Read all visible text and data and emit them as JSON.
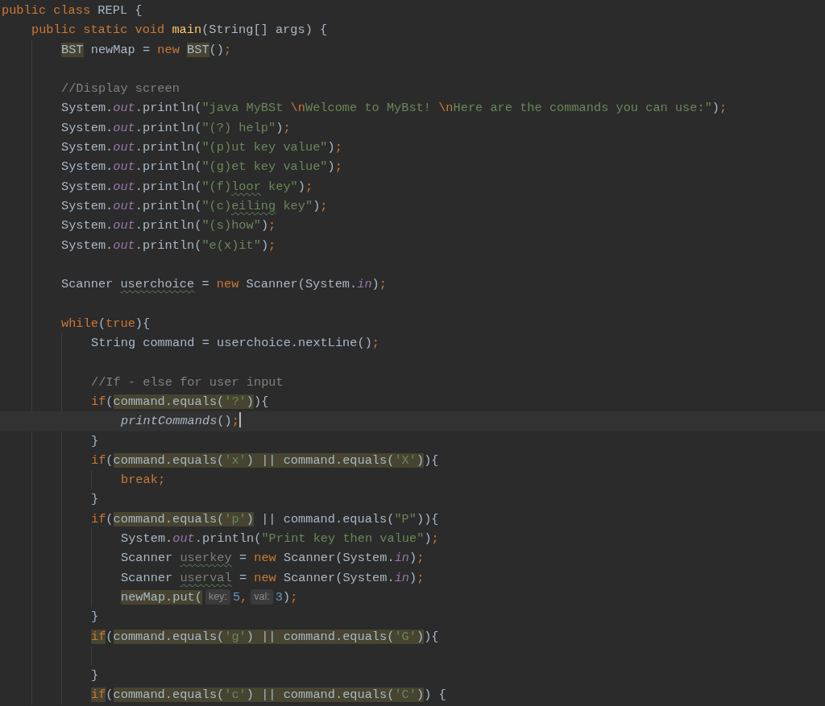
{
  "editor": {
    "lines": [
      {
        "current": false,
        "tokens": [
          {
            "text": "public class ",
            "kind": "kw",
            "highlight": false
          },
          {
            "text": "REPL {",
            "kind": "plain",
            "highlight": false
          }
        ],
        "children": [
          {
            "current": false,
            "tokens": [
              {
                "text": "public static void ",
                "kind": "kw",
                "highlight": false
              },
              {
                "text": "main",
                "kind": "method-decl",
                "highlight": false
              },
              {
                "text": "(String[] args) {",
                "kind": "plain",
                "highlight": false
              }
            ],
            "children": [
              {
                "current": false,
                "tokens": [
                  {
                    "text": "BST",
                    "kind": "plain",
                    "highlight": true
                  },
                  {
                    "text": " newMap = ",
                    "kind": "plain",
                    "highlight": false
                  },
                  {
                    "text": "new ",
                    "kind": "kw",
                    "highlight": false
                  },
                  {
                    "text": "BST",
                    "kind": "plain",
                    "highlight": true
                  },
                  {
                    "text": "()",
                    "kind": "plain",
                    "highlight": false
                  },
                  {
                    "text": ";",
                    "kind": "kw",
                    "highlight": false
                  }
                ]
              },
              {
                "current": false
              },
              {
                "current": false,
                "tokens": [
                  {
                    "text": "//Display screen",
                    "kind": "comment",
                    "highlight": false
                  }
                ]
              },
              {
                "current": false,
                "tokens": [
                  {
                    "text": "System.",
                    "kind": "plain",
                    "highlight": false
                  },
                  {
                    "text": "out",
                    "kind": "field",
                    "highlight": false
                  },
                  {
                    "text": ".println(",
                    "kind": "plain",
                    "highlight": false
                  },
                  {
                    "text": "\"java MyBSt ",
                    "kind": "str",
                    "highlight": false
                  },
                  {
                    "text": "\\n",
                    "kind": "escape",
                    "highlight": false
                  },
                  {
                    "text": "Welcome to MyBst! ",
                    "kind": "str",
                    "highlight": false
                  },
                  {
                    "text": "\\n",
                    "kind": "escape",
                    "highlight": false
                  },
                  {
                    "text": "Here are the commands you can use:\"",
                    "kind": "str",
                    "highlight": false
                  },
                  {
                    "text": ")",
                    "kind": "plain",
                    "highlight": false
                  },
                  {
                    "text": ";",
                    "kind": "kw",
                    "highlight": false
                  }
                ]
              },
              {
                "current": false,
                "tokens": [
                  {
                    "text": "System.",
                    "kind": "plain",
                    "highlight": false
                  },
                  {
                    "text": "out",
                    "kind": "field",
                    "highlight": false
                  },
                  {
                    "text": ".println(",
                    "kind": "plain",
                    "highlight": false
                  },
                  {
                    "text": "\"(?) help\"",
                    "kind": "str",
                    "highlight": false
                  },
                  {
                    "text": ")",
                    "kind": "plain",
                    "highlight": false
                  },
                  {
                    "text": ";",
                    "kind": "kw",
                    "highlight": false
                  }
                ]
              },
              {
                "current": false,
                "tokens": [
                  {
                    "text": "System.",
                    "kind": "plain",
                    "highlight": false
                  },
                  {
                    "text": "out",
                    "kind": "field",
                    "highlight": false
                  },
                  {
                    "text": ".println(",
                    "kind": "plain",
                    "highlight": false
                  },
                  {
                    "text": "\"(p)ut key value\"",
                    "kind": "str",
                    "highlight": false
                  },
                  {
                    "text": ")",
                    "kind": "plain",
                    "highlight": false
                  },
                  {
                    "text": ";",
                    "kind": "kw",
                    "highlight": false
                  }
                ]
              },
              {
                "current": false,
                "tokens": [
                  {
                    "text": "System.",
                    "kind": "plain",
                    "highlight": false
                  },
                  {
                    "text": "out",
                    "kind": "field",
                    "highlight": false
                  },
                  {
                    "text": ".println(",
                    "kind": "plain",
                    "highlight": false
                  },
                  {
                    "text": "\"(g)et key value\"",
                    "kind": "str",
                    "highlight": false
                  },
                  {
                    "text": ")",
                    "kind": "plain",
                    "highlight": false
                  },
                  {
                    "text": ";",
                    "kind": "kw",
                    "highlight": false
                  }
                ]
              },
              {
                "current": false,
                "tokens": [
                  {
                    "text": "System.",
                    "kind": "plain",
                    "highlight": false
                  },
                  {
                    "text": "out",
                    "kind": "field",
                    "highlight": false
                  },
                  {
                    "text": ".println(",
                    "kind": "plain",
                    "highlight": false
                  },
                  {
                    "text": "\"(f)",
                    "kind": "str",
                    "highlight": false
                  },
                  {
                    "text": "loor",
                    "kind": "str-typo",
                    "highlight": false
                  },
                  {
                    "text": " key\"",
                    "kind": "str",
                    "highlight": false
                  },
                  {
                    "text": ")",
                    "kind": "plain",
                    "highlight": false
                  },
                  {
                    "text": ";",
                    "kind": "kw",
                    "highlight": false
                  }
                ]
              },
              {
                "current": false,
                "tokens": [
                  {
                    "text": "System.",
                    "kind": "plain",
                    "highlight": false
                  },
                  {
                    "text": "out",
                    "kind": "field",
                    "highlight": false
                  },
                  {
                    "text": ".println(",
                    "kind": "plain",
                    "highlight": false
                  },
                  {
                    "text": "\"(c)",
                    "kind": "str",
                    "highlight": false
                  },
                  {
                    "text": "eiling",
                    "kind": "str-typo",
                    "highlight": false
                  },
                  {
                    "text": " key\"",
                    "kind": "str",
                    "highlight": false
                  },
                  {
                    "text": ")",
                    "kind": "plain",
                    "highlight": false
                  },
                  {
                    "text": ";",
                    "kind": "kw",
                    "highlight": false
                  }
                ]
              },
              {
                "current": false,
                "tokens": [
                  {
                    "text": "System.",
                    "kind": "plain",
                    "highlight": false
                  },
                  {
                    "text": "out",
                    "kind": "field",
                    "highlight": false
                  },
                  {
                    "text": ".println(",
                    "kind": "plain",
                    "highlight": false
                  },
                  {
                    "text": "\"(s)how\"",
                    "kind": "str",
                    "highlight": false
                  },
                  {
                    "text": ")",
                    "kind": "plain",
                    "highlight": false
                  },
                  {
                    "text": ";",
                    "kind": "kw",
                    "highlight": false
                  }
                ]
              },
              {
                "current": false,
                "tokens": [
                  {
                    "text": "System.",
                    "kind": "plain",
                    "highlight": false
                  },
                  {
                    "text": "out",
                    "kind": "field",
                    "highlight": false
                  },
                  {
                    "text": ".println(",
                    "kind": "plain",
                    "highlight": false
                  },
                  {
                    "text": "\"e(x)it\"",
                    "kind": "str",
                    "highlight": false
                  },
                  {
                    "text": ")",
                    "kind": "plain",
                    "highlight": false
                  },
                  {
                    "text": ";",
                    "kind": "kw",
                    "highlight": false
                  }
                ]
              },
              {
                "current": false
              },
              {
                "current": false,
                "tokens": [
                  {
                    "text": "Scanner ",
                    "kind": "plain",
                    "highlight": false
                  },
                  {
                    "text": "userchoice",
                    "kind": "plain-typo",
                    "highlight": false
                  },
                  {
                    "text": " = ",
                    "kind": "plain",
                    "highlight": false
                  },
                  {
                    "text": "new ",
                    "kind": "kw",
                    "highlight": false
                  },
                  {
                    "text": "Scanner(System.",
                    "kind": "plain",
                    "highlight": false
                  },
                  {
                    "text": "in",
                    "kind": "field",
                    "highlight": false
                  },
                  {
                    "text": ")",
                    "kind": "plain",
                    "highlight": false
                  },
                  {
                    "text": ";",
                    "kind": "kw",
                    "highlight": false
                  }
                ]
              },
              {
                "current": false
              },
              {
                "current": false,
                "tokens": [
                  {
                    "text": "while",
                    "kind": "kw",
                    "highlight": false
                  },
                  {
                    "text": "(",
                    "kind": "plain",
                    "highlight": false
                  },
                  {
                    "text": "true",
                    "kind": "kw",
                    "highlight": false
                  },
                  {
                    "text": "){",
                    "kind": "plain",
                    "highlight": false
                  }
                ],
                "children": [
                  {
                    "current": false,
                    "tokens": [
                      {
                        "text": "String command = userchoice.nextLine()",
                        "kind": "plain",
                        "highlight": false
                      },
                      {
                        "text": ";",
                        "kind": "kw",
                        "highlight": false
                      }
                    ]
                  },
                  {
                    "current": false
                  },
                  {
                    "current": false,
                    "tokens": [
                      {
                        "text": "//If - else for user input",
                        "kind": "comment",
                        "highlight": false
                      }
                    ]
                  },
                  {
                    "current": false,
                    "tokens": [
                      {
                        "text": "if",
                        "kind": "kw",
                        "highlight": false
                      },
                      {
                        "text": "(",
                        "kind": "plain",
                        "highlight": false
                      },
                      {
                        "text": "command.equals(",
                        "kind": "plain",
                        "highlight": true
                      },
                      {
                        "text": "'?'",
                        "kind": "str",
                        "highlight": true
                      },
                      {
                        "text": ")",
                        "kind": "plain",
                        "highlight": true
                      },
                      {
                        "text": "){",
                        "kind": "plain",
                        "highlight": false
                      }
                    ],
                    "children": [
                      {
                        "current": true,
                        "tokens": [
                          {
                            "text": "printCommands",
                            "kind": "static-call",
                            "highlight": false
                          },
                          {
                            "text": "()",
                            "kind": "plain",
                            "highlight": false
                          },
                          {
                            "text": ";",
                            "kind": "kw",
                            "highlight": false
                          }
                        ]
                      }
                    ]
                  },
                  {
                    "current": false,
                    "tokens": [
                      {
                        "text": "}",
                        "kind": "plain",
                        "highlight": false
                      }
                    ]
                  },
                  {
                    "current": false,
                    "tokens": [
                      {
                        "text": "if",
                        "kind": "kw",
                        "highlight": false
                      },
                      {
                        "text": "(",
                        "kind": "plain",
                        "highlight": false
                      },
                      {
                        "text": "command.equals(",
                        "kind": "plain",
                        "highlight": true
                      },
                      {
                        "text": "'x'",
                        "kind": "str",
                        "highlight": true
                      },
                      {
                        "text": ") || command.equals(",
                        "kind": "plain",
                        "highlight": true
                      },
                      {
                        "text": "'X'",
                        "kind": "str",
                        "highlight": true
                      },
                      {
                        "text": ")",
                        "kind": "plain",
                        "highlight": true
                      },
                      {
                        "text": "){",
                        "kind": "plain",
                        "highlight": false
                      }
                    ],
                    "children": [
                      {
                        "current": false,
                        "tokens": [
                          {
                            "text": "break;",
                            "kind": "kw",
                            "highlight": false
                          }
                        ]
                      }
                    ]
                  },
                  {
                    "current": false,
                    "tokens": [
                      {
                        "text": "}",
                        "kind": "plain",
                        "highlight": false
                      }
                    ]
                  },
                  {
                    "current": false,
                    "tokens": [
                      {
                        "text": "if",
                        "kind": "kw",
                        "highlight": false
                      },
                      {
                        "text": "(",
                        "kind": "plain",
                        "highlight": false
                      },
                      {
                        "text": "command.equals(",
                        "kind": "plain",
                        "highlight": true
                      },
                      {
                        "text": "'p'",
                        "kind": "str",
                        "highlight": true
                      },
                      {
                        "text": ")",
                        "kind": "plain",
                        "highlight": true
                      },
                      {
                        "text": " || command.equals(",
                        "kind": "plain",
                        "highlight": false
                      },
                      {
                        "text": "\"P\"",
                        "kind": "str",
                        "highlight": false
                      },
                      {
                        "text": ")){",
                        "kind": "plain",
                        "highlight": false
                      }
                    ],
                    "children": [
                      {
                        "current": false,
                        "tokens": [
                          {
                            "text": "System.",
                            "kind": "plain",
                            "highlight": false
                          },
                          {
                            "text": "out",
                            "kind": "field",
                            "highlight": false
                          },
                          {
                            "text": ".println(",
                            "kind": "plain",
                            "highlight": false
                          },
                          {
                            "text": "\"Print key then value\"",
                            "kind": "str",
                            "highlight": false
                          },
                          {
                            "text": ")",
                            "kind": "plain",
                            "highlight": false
                          },
                          {
                            "text": ";",
                            "kind": "kw",
                            "highlight": false
                          }
                        ]
                      },
                      {
                        "current": false,
                        "tokens": [
                          {
                            "text": "Scanner ",
                            "kind": "plain",
                            "highlight": false
                          },
                          {
                            "text": "userkey",
                            "kind": "unused",
                            "highlight": false
                          },
                          {
                            "text": " = ",
                            "kind": "plain",
                            "highlight": false
                          },
                          {
                            "text": "new ",
                            "kind": "kw",
                            "highlight": false
                          },
                          {
                            "text": "Scanner(System.",
                            "kind": "plain",
                            "highlight": false
                          },
                          {
                            "text": "in",
                            "kind": "field",
                            "highlight": false
                          },
                          {
                            "text": ")",
                            "kind": "plain",
                            "highlight": false
                          },
                          {
                            "text": ";",
                            "kind": "kw",
                            "highlight": false
                          }
                        ]
                      },
                      {
                        "current": false,
                        "tokens": [
                          {
                            "text": "Scanner ",
                            "kind": "plain",
                            "highlight": false
                          },
                          {
                            "text": "userval",
                            "kind": "unused",
                            "highlight": false
                          },
                          {
                            "text": " = ",
                            "kind": "plain",
                            "highlight": false
                          },
                          {
                            "text": "new ",
                            "kind": "kw",
                            "highlight": false
                          },
                          {
                            "text": "Scanner(System.",
                            "kind": "plain",
                            "highlight": false
                          },
                          {
                            "text": "in",
                            "kind": "field",
                            "highlight": false
                          },
                          {
                            "text": ")",
                            "kind": "plain",
                            "highlight": false
                          },
                          {
                            "text": ";",
                            "kind": "kw",
                            "highlight": false
                          }
                        ]
                      },
                      {
                        "current": false,
                        "tokens": [
                          {
                            "text": "newMap.put(",
                            "kind": "plain",
                            "highlight": true
                          },
                          {
                            "text": "key:",
                            "kind": "hint",
                            "highlight": false
                          },
                          {
                            "text": "5",
                            "kind": "num",
                            "highlight": false
                          },
                          {
                            "text": ",",
                            "kind": "kw",
                            "highlight": false
                          },
                          {
                            "text": "val:",
                            "kind": "hint",
                            "highlight": false
                          },
                          {
                            "text": "3",
                            "kind": "num",
                            "highlight": false
                          },
                          {
                            "text": ")",
                            "kind": "plain",
                            "highlight": false
                          },
                          {
                            "text": ";",
                            "kind": "kw",
                            "highlight": false
                          }
                        ]
                      }
                    ]
                  },
                  {
                    "current": false,
                    "tokens": [
                      {
                        "text": "}",
                        "kind": "plain",
                        "highlight": false
                      }
                    ]
                  },
                  {
                    "current": false,
                    "tokens": [
                      {
                        "text": "if",
                        "kind": "kw",
                        "highlight": true
                      },
                      {
                        "text": "(",
                        "kind": "plain",
                        "highlight": false
                      },
                      {
                        "text": "command.equals(",
                        "kind": "plain",
                        "highlight": true
                      },
                      {
                        "text": "'g'",
                        "kind": "str",
                        "highlight": true
                      },
                      {
                        "text": ") || command.equals(",
                        "kind": "plain",
                        "highlight": true
                      },
                      {
                        "text": "'G'",
                        "kind": "str",
                        "highlight": true
                      },
                      {
                        "text": ")",
                        "kind": "plain",
                        "highlight": true
                      },
                      {
                        "text": "){",
                        "kind": "plain",
                        "highlight": false
                      }
                    ],
                    "children": [
                      {
                        "current": false
                      }
                    ]
                  },
                  {
                    "current": false,
                    "tokens": [
                      {
                        "text": "}",
                        "kind": "plain",
                        "highlight": false
                      }
                    ]
                  },
                  {
                    "current": false,
                    "tokens": [
                      {
                        "text": "if",
                        "kind": "kw",
                        "highlight": true
                      },
                      {
                        "text": "(",
                        "kind": "plain",
                        "highlight": false
                      },
                      {
                        "text": "command.equals(",
                        "kind": "plain",
                        "highlight": true
                      },
                      {
                        "text": "'c'",
                        "kind": "str",
                        "highlight": true
                      },
                      {
                        "text": ") || command.equals(",
                        "kind": "plain",
                        "highlight": true
                      },
                      {
                        "text": "'C'",
                        "kind": "str",
                        "highlight": true
                      },
                      {
                        "text": ")",
                        "kind": "plain",
                        "highlight": true
                      },
                      {
                        "text": ") {",
                        "kind": "plain",
                        "highlight": false
                      }
                    ]
                  }
                ]
              }
            ]
          }
        ]
      }
    ]
  }
}
